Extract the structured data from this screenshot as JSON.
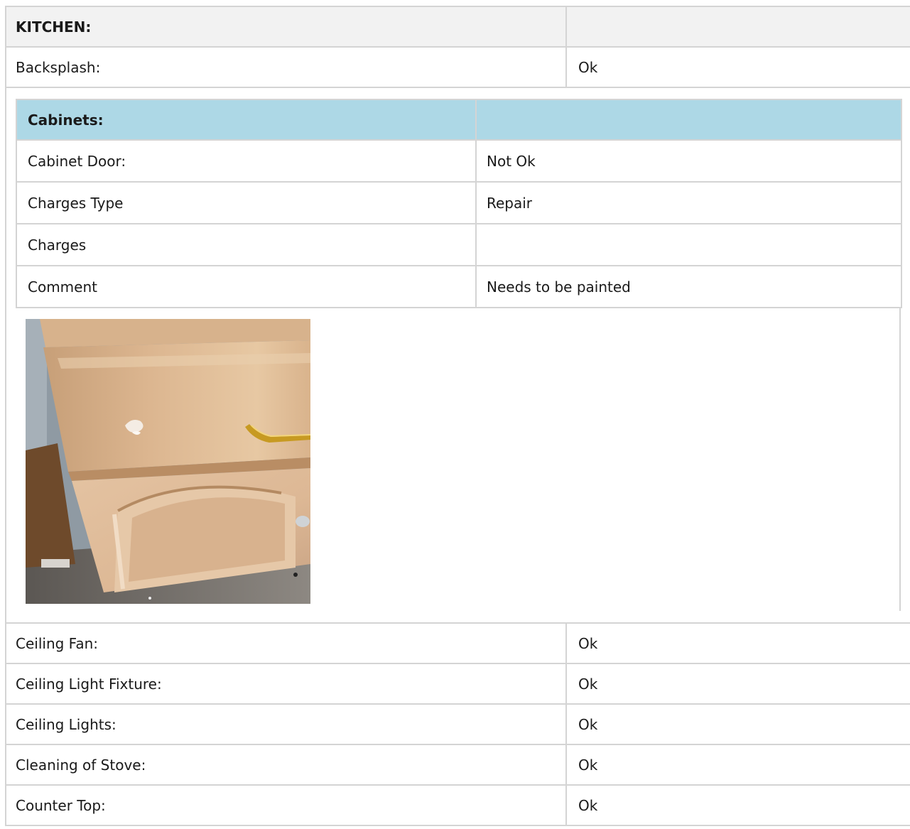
{
  "kitchen": {
    "header": {
      "label": "KITCHEN:",
      "value": ""
    },
    "rows_before": [
      {
        "label": "Backsplash:",
        "value": "Ok"
      }
    ],
    "cabinets": {
      "header": {
        "label": "Cabinets:",
        "value": ""
      },
      "rows": [
        {
          "label": "Cabinet Door:",
          "value": "Not Ok"
        },
        {
          "label": "Charges Type",
          "value": "Repair"
        },
        {
          "label": "Charges",
          "value": ""
        },
        {
          "label": "Comment",
          "value": "Needs to be painted"
        }
      ],
      "photo": {
        "alt": "cabinet-door-damage-photo"
      }
    },
    "rows_after": [
      {
        "label": "Ceiling Fan:",
        "value": "Ok"
      },
      {
        "label": "Ceiling Light Fixture:",
        "value": "Ok"
      },
      {
        "label": "Ceiling Lights:",
        "value": "Ok"
      },
      {
        "label": "Cleaning of Stove:",
        "value": "Ok"
      },
      {
        "label": "Counter Top:",
        "value": "Ok"
      }
    ]
  }
}
